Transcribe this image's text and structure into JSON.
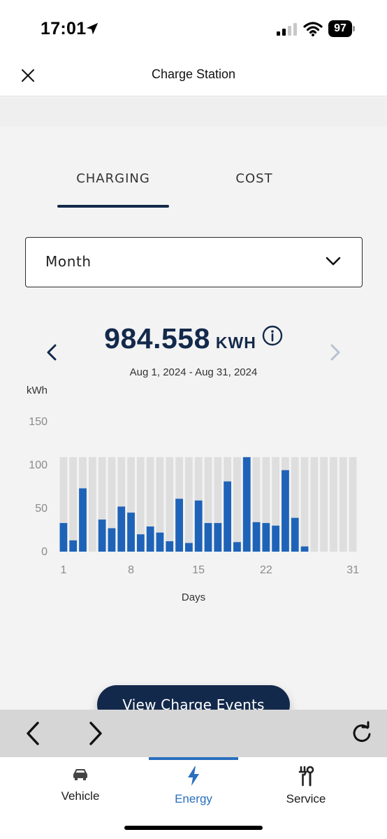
{
  "status_bar": {
    "time": "17:01",
    "battery": "97"
  },
  "header": {
    "title": "Charge Station"
  },
  "tabs": [
    {
      "label": "CHARGING",
      "active": true
    },
    {
      "label": "COST",
      "active": false
    }
  ],
  "period_select": {
    "value": "Month"
  },
  "summary": {
    "total": "984.558",
    "unit": "KWH",
    "date_range": "Aug 1, 2024 - Aug 31, 2024"
  },
  "chart_data": {
    "type": "bar",
    "ylabel": "kWh",
    "xlabel": "Days",
    "ylim": [
      0,
      150
    ],
    "yticks": [
      "0",
      "50",
      "100",
      "150"
    ],
    "xticks": [
      "1",
      "8",
      "15",
      "22",
      "31"
    ],
    "x": [
      1,
      2,
      3,
      4,
      5,
      6,
      7,
      8,
      9,
      10,
      11,
      12,
      13,
      14,
      15,
      16,
      17,
      18,
      19,
      20,
      21,
      22,
      23,
      24,
      25,
      26,
      27,
      28,
      29,
      30,
      31
    ],
    "values": [
      33,
      13,
      73,
      0,
      37,
      27,
      52,
      45,
      20,
      29,
      22,
      12,
      61,
      10,
      59,
      33,
      33,
      81,
      11,
      109,
      34,
      33,
      30,
      94,
      39,
      6,
      0,
      0,
      0,
      0,
      0
    ],
    "background_bar_value": 109,
    "colors": {
      "bar": "#1e63b8",
      "background_bar": "#dedede"
    },
    "grid": false
  },
  "cta": {
    "label": "View Charge Events"
  },
  "nav": {
    "items": [
      {
        "label": "Vehicle",
        "icon": "car-icon",
        "active": false
      },
      {
        "label": "Energy",
        "icon": "bolt-icon",
        "active": true
      },
      {
        "label": "Service",
        "icon": "tools-icon",
        "active": false
      }
    ]
  },
  "colors": {
    "brand": "#13294b",
    "accent": "#2a6ebe"
  }
}
